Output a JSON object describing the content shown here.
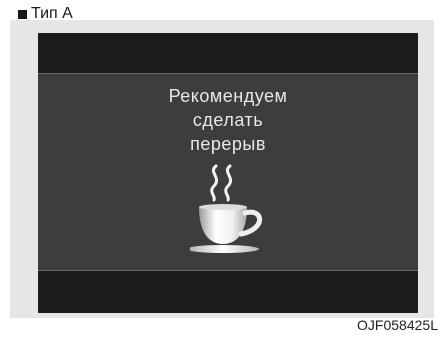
{
  "header": {
    "type_label": "Тип А"
  },
  "screen": {
    "message_lines": [
      "Рекомендуем",
      "сделать",
      "перерыв"
    ],
    "icon": "coffee-cup-icon"
  },
  "footer": {
    "code": "OJF058425L"
  },
  "colors": {
    "panel_bg": "#e6e6e6",
    "screen_dark": "#1c1c1c",
    "screen_middle": "#3d3d3d",
    "text_light": "#e8e8e8"
  }
}
